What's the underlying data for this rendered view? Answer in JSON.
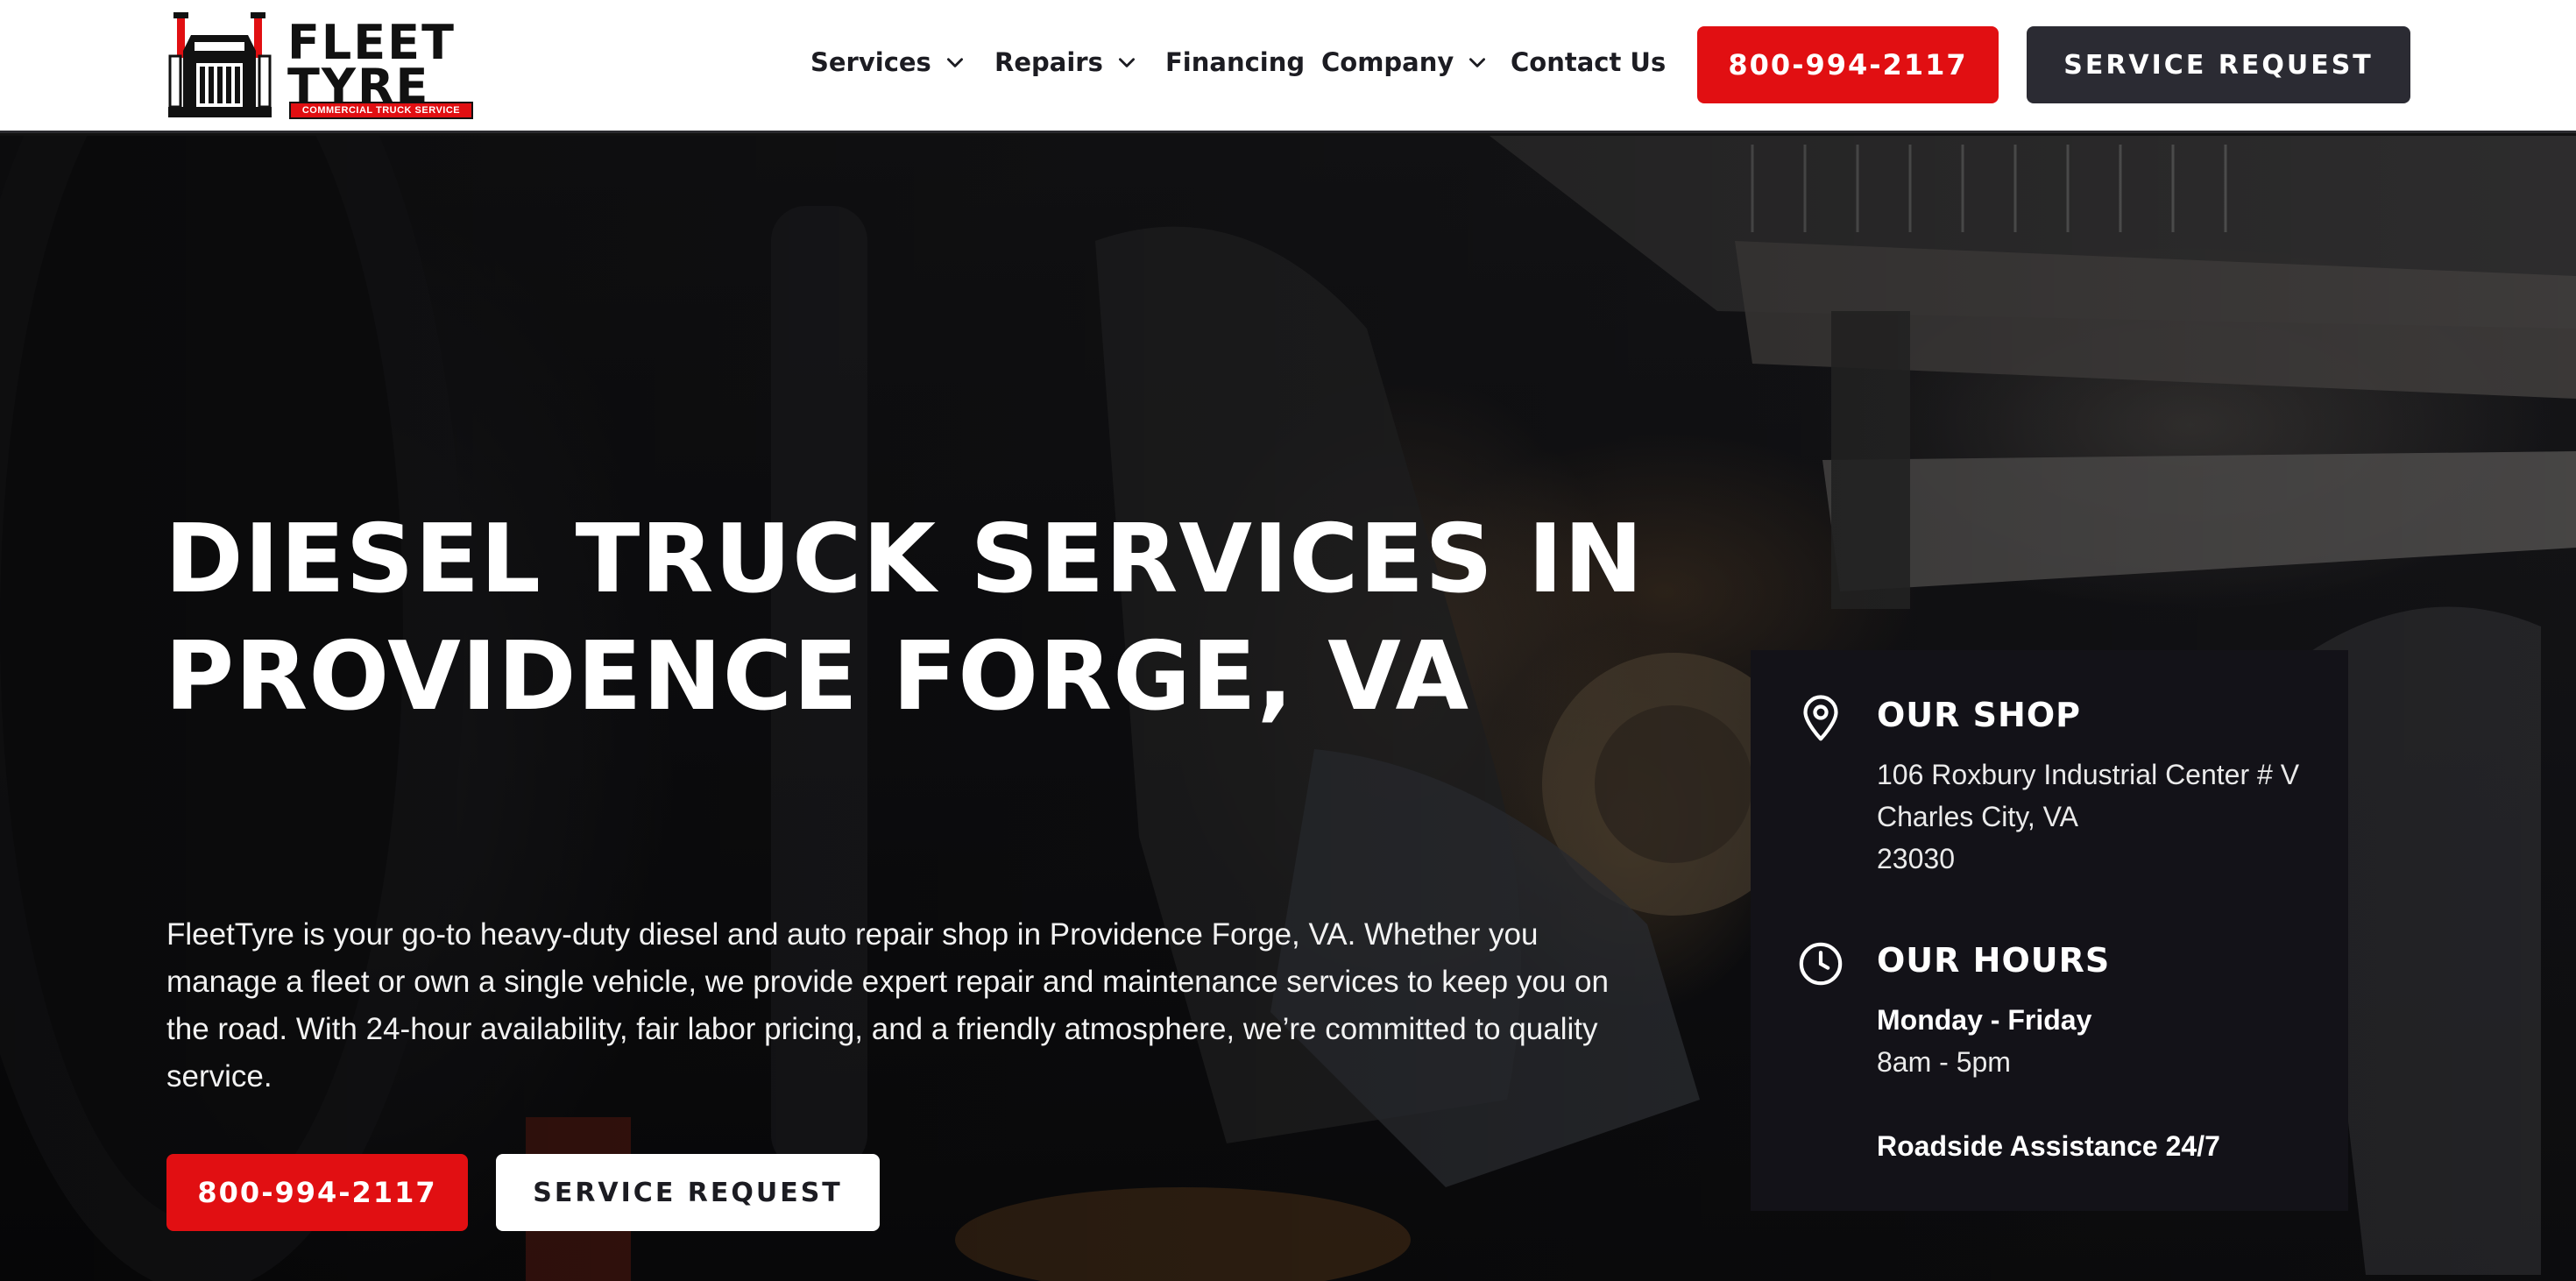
{
  "brand": {
    "name_line1": "FLEET",
    "name_line2": "TYRE",
    "tagline": "COMMERCIAL TRUCK SERVICE",
    "accent_color": "#e10f12",
    "dark_color": "#2b2b33"
  },
  "nav": {
    "items": [
      {
        "label": "Services",
        "has_dropdown": true
      },
      {
        "label": "Repairs",
        "has_dropdown": true
      },
      {
        "label": "Financing",
        "has_dropdown": false
      },
      {
        "label": "Company",
        "has_dropdown": true
      },
      {
        "label": "Contact Us",
        "has_dropdown": false
      }
    ],
    "phone_button": "800-994-2117",
    "request_button": "SERVICE REQUEST"
  },
  "hero": {
    "title_line1": "DIESEL TRUCK SERVICES IN",
    "title_line2": "PROVIDENCE FORGE, VA",
    "description": "FleetTyre is your go-to heavy-duty diesel and auto repair shop in Providence Forge, VA. Whether you manage a fleet or own a single vehicle, we provide expert repair and maintenance services to keep you on the road. With 24-hour availability, fair labor pricing, and a friendly atmosphere, we’re committed to quality service.",
    "phone_button": "800-994-2117",
    "request_button": "SERVICE REQUEST"
  },
  "info": {
    "shop_heading": "OUR SHOP",
    "address_line1": "106 Roxbury Industrial Center # V",
    "address_line2": "Charles City, VA",
    "address_line3": "23030",
    "hours_heading": "OUR HOURS",
    "days": "Monday - Friday",
    "hours": "8am - 5pm",
    "roadside": "Roadside Assistance 24/7",
    "icons": [
      "map-pin-icon",
      "clock-icon"
    ]
  }
}
